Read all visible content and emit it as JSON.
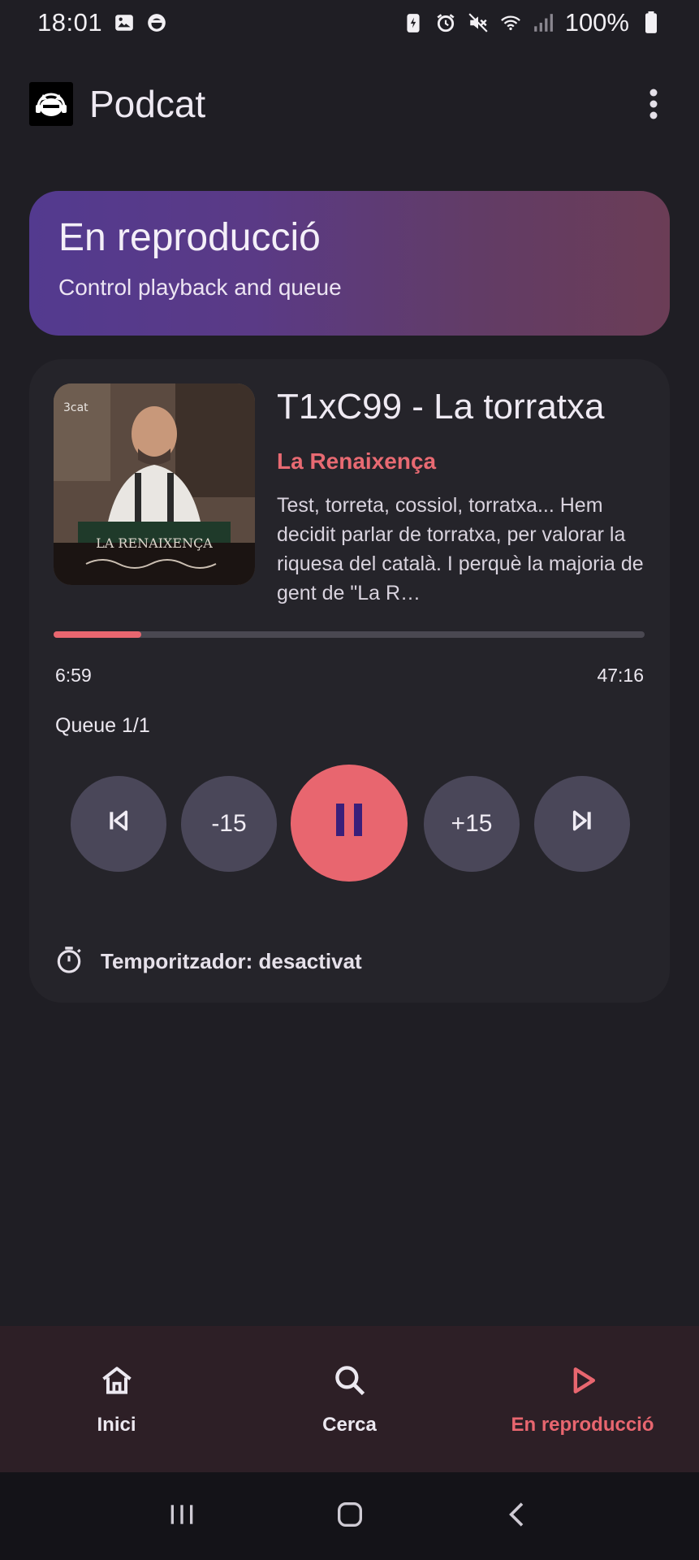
{
  "status_bar": {
    "time": "18:01",
    "battery_percent": "100%",
    "icons": [
      "gallery-icon",
      "app-notification-icon",
      "battery-saver-icon",
      "alarm-icon",
      "mute-icon",
      "wifi-icon",
      "signal-icon",
      "battery-icon"
    ]
  },
  "app_bar": {
    "title": "Podcat",
    "logo_icon": "headphones-cat-icon",
    "menu_icon": "more-vert-icon"
  },
  "hero": {
    "title": "En reproducció",
    "subtitle": "Control playback and queue"
  },
  "player": {
    "artwork_caption": "LA RENAIXENÇA",
    "artwork_brand": "3cat",
    "episode_title": "T1xC99 - La torratxa",
    "podcast_name": "La Renaixença",
    "description": "Test, torreta, cossiol, torratxa... Hem decidit parlar de torratxa, per valorar la riquesa del català. I perquè la majoria de gent de \"La R…",
    "elapsed": "6:59",
    "total": "47:16",
    "progress_fraction": 0.148,
    "queue_label": "Queue 1/1",
    "controls": {
      "skip_back_label": "-15",
      "skip_forward_label": "+15"
    },
    "timer_label": "Temporitzador: desactivat"
  },
  "bottom_nav": {
    "items": [
      {
        "label": "Inici",
        "icon": "home-icon",
        "active": false
      },
      {
        "label": "Cerca",
        "icon": "search-icon",
        "active": false
      },
      {
        "label": "En reproducció",
        "icon": "play-icon",
        "active": true
      }
    ]
  },
  "colors": {
    "accent": "#e8666f",
    "background": "#1f1e24",
    "card": "#25242a",
    "control": "#4a4759",
    "pause_bars": "#3a1f7a"
  }
}
